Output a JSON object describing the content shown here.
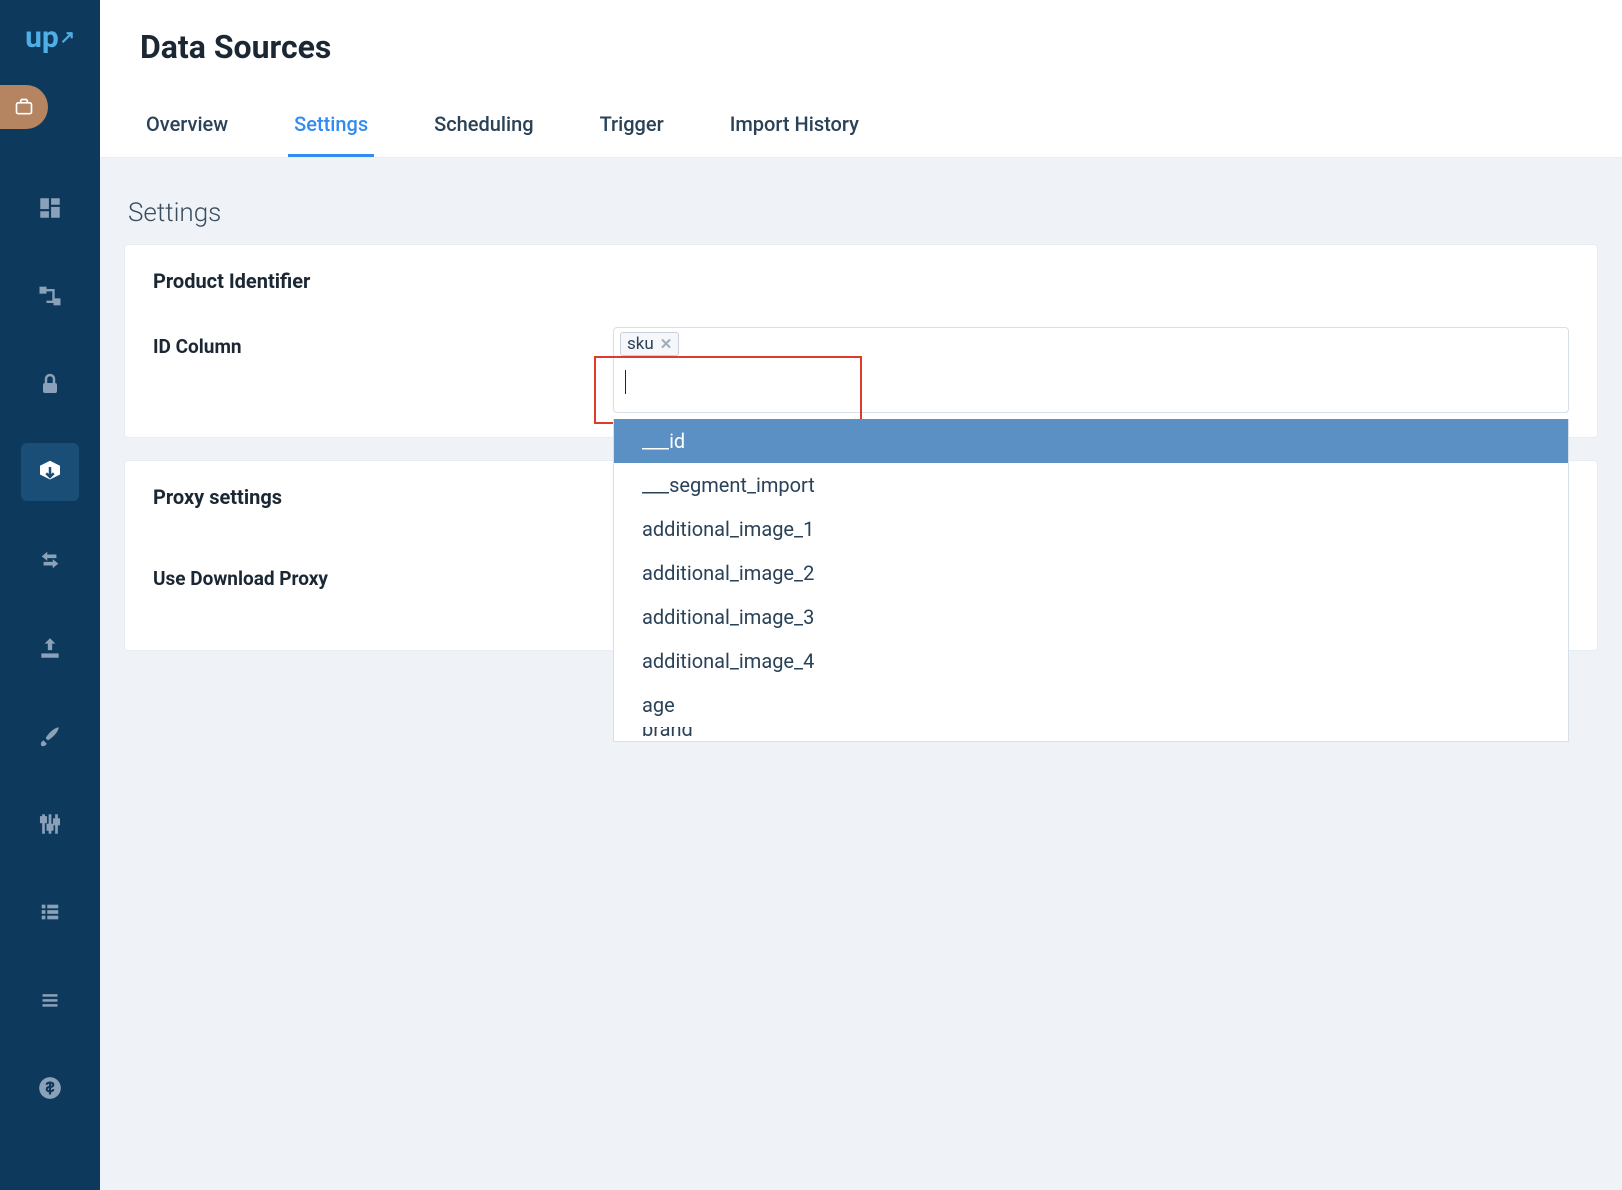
{
  "header": {
    "title": "Data Sources"
  },
  "tabs": [
    {
      "label": "Overview",
      "active": false
    },
    {
      "label": "Settings",
      "active": true
    },
    {
      "label": "Scheduling",
      "active": false
    },
    {
      "label": "Trigger",
      "active": false
    },
    {
      "label": "Import History",
      "active": false
    }
  ],
  "section": {
    "title": "Settings"
  },
  "panels": {
    "product_identifier": {
      "title": "Product Identifier",
      "id_column": {
        "label": "ID Column",
        "chip": "sku",
        "input_value": "",
        "dropdown_options": [
          {
            "label": "___id",
            "highlighted": true
          },
          {
            "label": "___segment_import",
            "highlighted": false
          },
          {
            "label": "additional_image_1",
            "highlighted": false
          },
          {
            "label": "additional_image_2",
            "highlighted": false
          },
          {
            "label": "additional_image_3",
            "highlighted": false
          },
          {
            "label": "additional_image_4",
            "highlighted": false
          },
          {
            "label": "age",
            "highlighted": false
          },
          {
            "label": "brand",
            "highlighted": false
          }
        ]
      }
    },
    "proxy": {
      "title": "Proxy settings",
      "use_download_proxy": {
        "label": "Use Download Proxy"
      }
    }
  },
  "colors": {
    "sidebar_bg": "#0d3a5c",
    "accent": "#328cef",
    "highlight_red": "#de3b2b",
    "option_highlight": "#5b90c4",
    "content_bg": "#eff3f7"
  }
}
